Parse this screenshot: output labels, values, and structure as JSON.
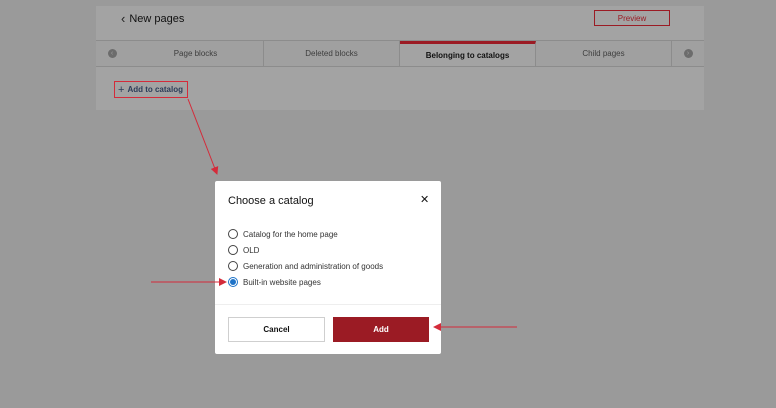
{
  "header": {
    "title": "New pages",
    "preview_label": "Preview"
  },
  "tabs": [
    {
      "label": "Page blocks",
      "active": false
    },
    {
      "label": "Deleted blocks",
      "active": false
    },
    {
      "label": "Belonging to catalogs",
      "active": true
    },
    {
      "label": "Child pages",
      "active": false
    }
  ],
  "toolbar": {
    "add_to_catalog_label": "Add to catalog"
  },
  "modal": {
    "title": "Choose a catalog",
    "options": [
      {
        "label": "Catalog for the home page",
        "selected": false
      },
      {
        "label": "OLD",
        "selected": false
      },
      {
        "label": "Generation and administration of goods",
        "selected": false
      },
      {
        "label": "Built-in website pages",
        "selected": true
      }
    ],
    "cancel_label": "Cancel",
    "add_label": "Add"
  },
  "colors": {
    "accent": "#9b1b24",
    "annotation": "#d42b3a",
    "radio_selected": "#1e73c8",
    "overlay": "#9a9a9a"
  }
}
